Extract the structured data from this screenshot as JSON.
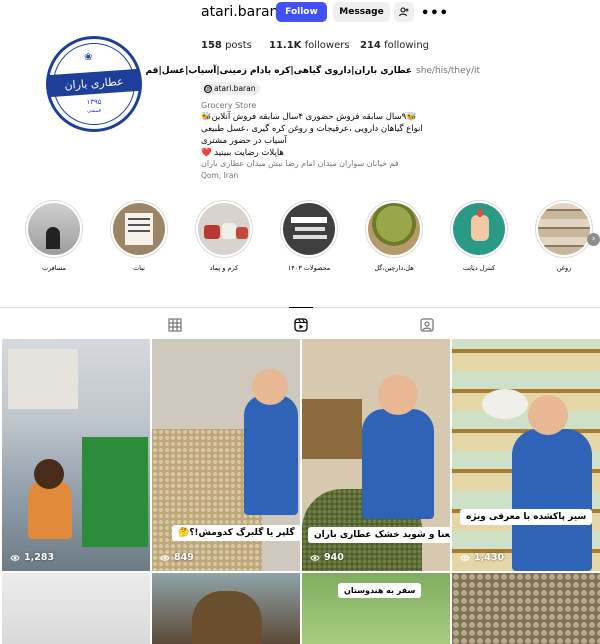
{
  "profile": {
    "username": "atari.baran",
    "follow_label": "Follow",
    "message_label": "Message",
    "more_label": "•••",
    "posts_count": "158",
    "posts_label": "posts",
    "followers_count": "11.1K",
    "followers_label": "followers",
    "following_count": "214",
    "following_label": "following",
    "display_name": "عطاری باران|داروی گیاهی|کره بادام زمینی|آسیاب|عسل|قم",
    "pronouns": "she/his/they/it",
    "threads_handle": "atari.baran",
    "category": "Grocery Store",
    "bio_lines": [
      "🐝۹سال سابقه فروش حضوری ۴سال سابقه فروش آنلاین🐝",
      "انواع گیاهان دارویی ،عرقیجات و روغن کره گیری ،عسل طبیعی",
      "آسیاب در حضور مشتری",
      "هاپلات رضایت ببینید ❤️"
    ],
    "address": "قم خیابان سواران میدان امام رضا نبش میدان عطاری باران",
    "city": "Qom, Iran",
    "logo_text": "عطاری باران",
    "logo_subtext": "۱۳۹۵",
    "logo_small": "قمشی"
  },
  "highlights": [
    {
      "label": "روغن",
      "color": "#b7a58e"
    },
    {
      "label": "کنترل دیابت",
      "color": "#2a9a86"
    },
    {
      "label": "هل،دارچین،گل",
      "color": "#7b8a3a"
    },
    {
      "label": "محصولات ۱۴۰۳",
      "color": "#555555"
    },
    {
      "label": "کرم و پماد",
      "color": "#b34a3c"
    },
    {
      "label": "نبات",
      "color": "#9c8466"
    },
    {
      "label": "مسافرت",
      "color": "#b9b9b9"
    }
  ],
  "tabs": {
    "grid_icon": "grid-icon",
    "reels_icon": "reels-icon",
    "tagged_icon": "tagged-icon"
  },
  "posts": [
    {
      "views": "1,283",
      "caption": ""
    },
    {
      "views": "849",
      "caption": "گلپر یا گلبرگ کدومش!؟🤔"
    },
    {
      "views": "940",
      "caption": "نعنا و شوید خشک عطاری باران"
    },
    {
      "views": "1,430",
      "caption": "سیر پاکشده با معرفی ویژه"
    },
    {
      "views": "",
      "caption": ""
    },
    {
      "views": "",
      "caption": ""
    },
    {
      "views": "",
      "caption": "سفر به هندوستان"
    },
    {
      "views": "",
      "caption": ""
    }
  ],
  "colors": {
    "follow_button": "#4150f7",
    "logo_blue": "#1d3f9a"
  }
}
